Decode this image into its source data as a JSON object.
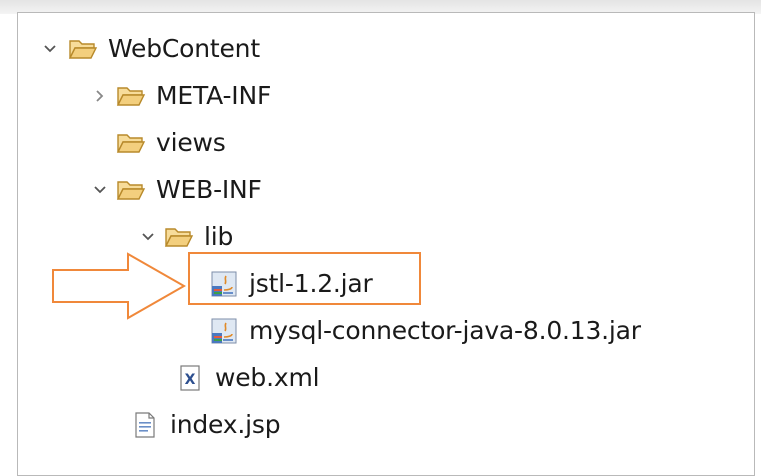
{
  "tree": {
    "items": [
      {
        "label": "WebContent",
        "icon": "folder-open-icon",
        "expanded": true
      },
      {
        "label": "META-INF",
        "icon": "folder-open-icon",
        "expanded": false
      },
      {
        "label": "views",
        "icon": "folder-open-icon"
      },
      {
        "label": "WEB-INF",
        "icon": "folder-open-icon",
        "expanded": true
      },
      {
        "label": "lib",
        "icon": "folder-open-icon",
        "expanded": true
      },
      {
        "label": "jstl-1.2.jar",
        "icon": "jar-icon",
        "highlighted": true
      },
      {
        "label": "mysql-connector-java-8.0.13.jar",
        "icon": "jar-icon"
      },
      {
        "label": "web.xml",
        "icon": "xml-file-icon"
      },
      {
        "label": "index.jsp",
        "icon": "jsp-file-icon"
      }
    ]
  },
  "colors": {
    "folder_fill": "#f3cf7e",
    "folder_stroke": "#b88a2b",
    "highlight": "#f0883a",
    "twisty": "#555555"
  }
}
